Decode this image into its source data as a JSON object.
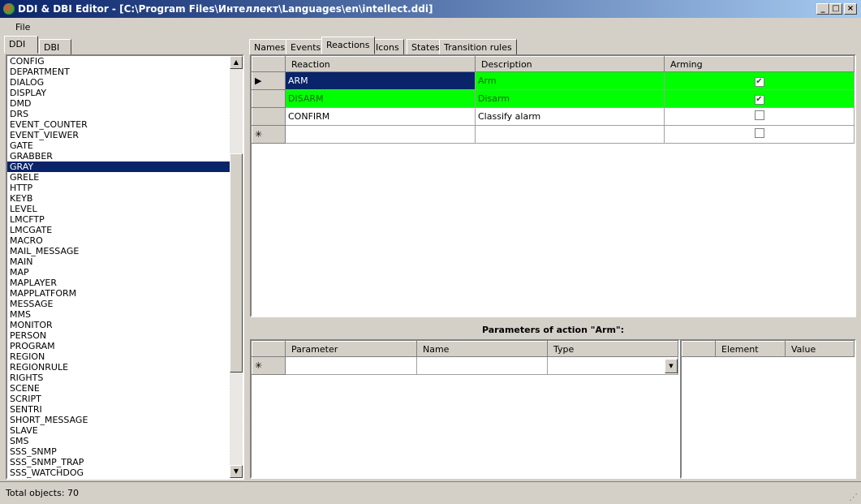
{
  "window": {
    "title": "DDI & DBI Editor - [C:\\Program Files\\Интеллект\\Languages\\en\\intellect.ddi]",
    "minimize": "_",
    "maximize": "□",
    "close": "×"
  },
  "menu": {
    "file": "File"
  },
  "left_tabs": [
    "DDI",
    "DBI"
  ],
  "objects": [
    "CONFIG",
    "DEPARTMENT",
    "DIALOG",
    "DISPLAY",
    "DMD",
    "DRS",
    "EVENT_COUNTER",
    "EVENT_VIEWER",
    "GATE",
    "GRABBER",
    "GRAY",
    "GRELE",
    "HTTP",
    "KEYB",
    "LEVEL",
    "LMCFTP",
    "LMCGATE",
    "MACRO",
    "MAIL_MESSAGE",
    "MAIN",
    "MAP",
    "MAPLAYER",
    "MAPPLATFORM",
    "MESSAGE",
    "MMS",
    "MONITOR",
    "PERSON",
    "PROGRAM",
    "REGION",
    "REGIONRULE",
    "RIGHTS",
    "SCENE",
    "SCRIPT",
    "SENTRI",
    "SHORT_MESSAGE",
    "SLAVE",
    "SMS",
    "SSS_SNMP",
    "SSS_SNMP_TRAP",
    "SSS_WATCHDOG"
  ],
  "selected_object": "GRAY",
  "right_tabs": [
    "Names",
    "Events",
    "Reactions",
    "Icons",
    "States",
    "Transition rules"
  ],
  "active_tab": "Reactions",
  "reactions": {
    "columns": [
      "Reaction",
      "Description",
      "Arming"
    ],
    "rows": [
      {
        "reaction": "ARM",
        "description": "Arm",
        "arming": true
      },
      {
        "reaction": "DISARM",
        "description": "Disarm",
        "arming": true
      },
      {
        "reaction": "CONFIRM",
        "description": "Classify alarm",
        "arming": false
      }
    ]
  },
  "parameters": {
    "title": "Parameters of action \"Arm\":",
    "columns": [
      "Parameter",
      "Name",
      "Type"
    ],
    "element_columns": [
      "Element",
      "Value"
    ]
  },
  "status": {
    "text": "Total objects: 70"
  },
  "colors": {
    "highlight": "#00ff00",
    "selection": "#0a246a"
  }
}
